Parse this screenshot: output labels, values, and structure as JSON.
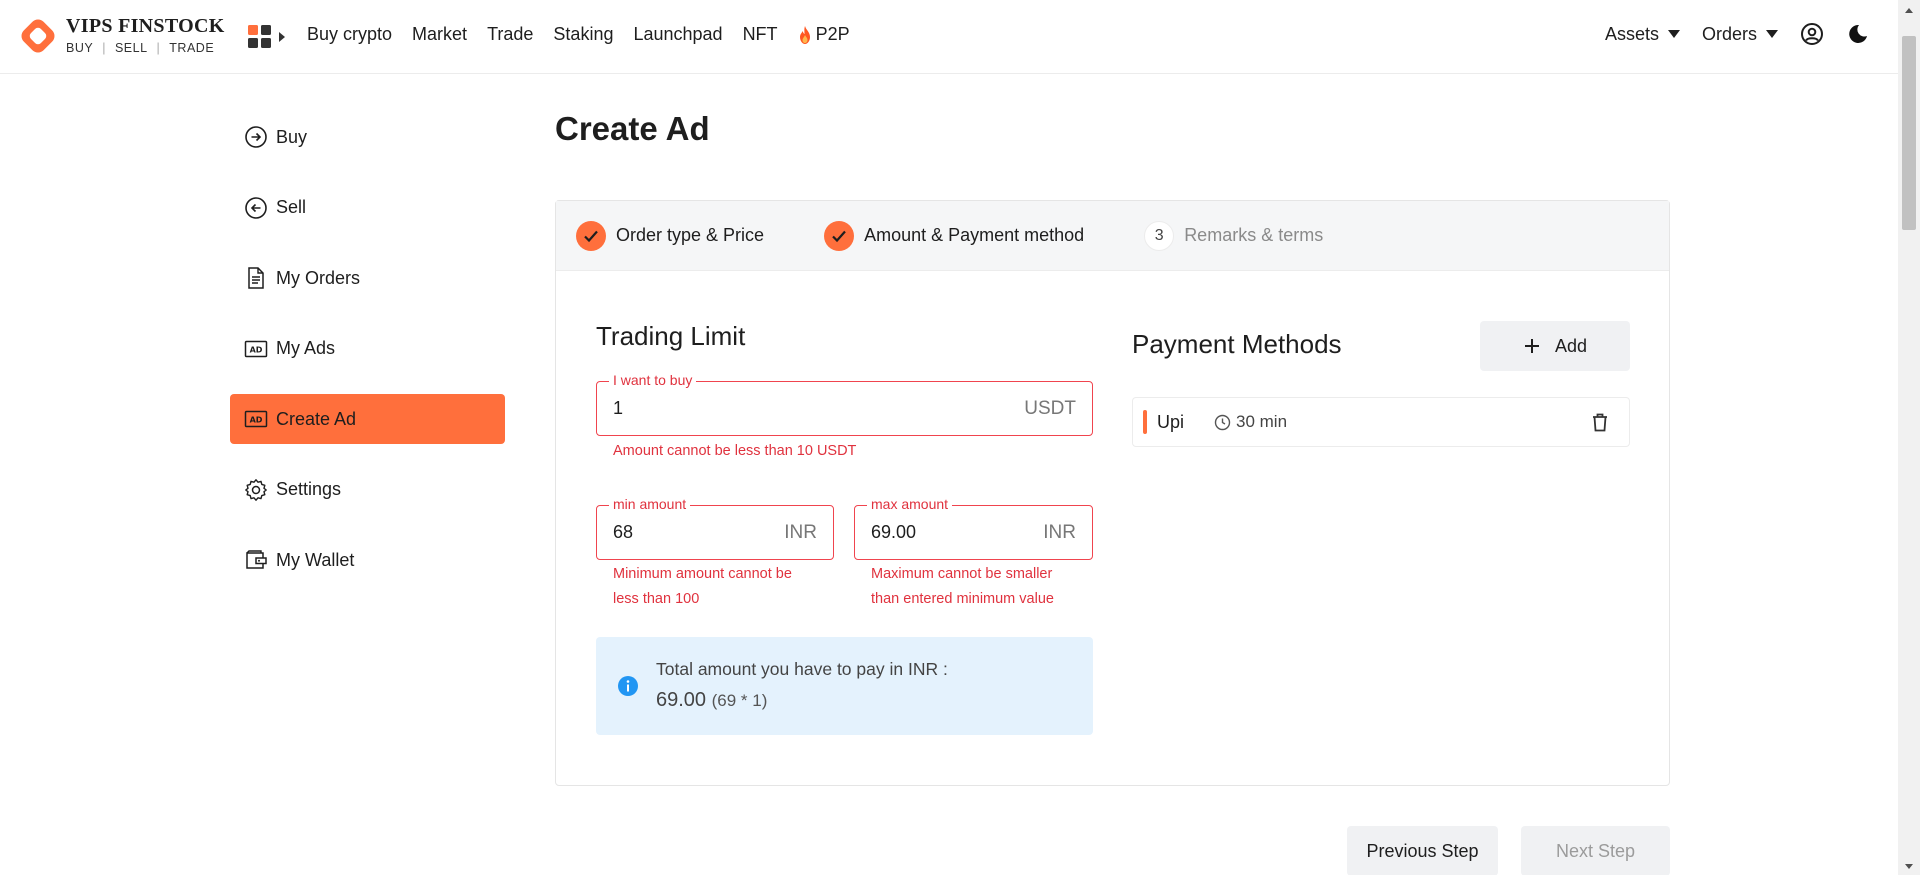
{
  "brand": {
    "name": "VIPS FINSTOCK",
    "tag_buy": "BUY",
    "tag_sell": "SELL",
    "tag_trade": "TRADE",
    "accent": "#ff6f3c"
  },
  "nav": {
    "links": [
      "Buy crypto",
      "Market",
      "Trade",
      "Staking",
      "Launchpad",
      "NFT",
      "P2P"
    ],
    "assets": "Assets",
    "orders": "Orders"
  },
  "sidebar": {
    "items": [
      {
        "label": "Buy",
        "icon": "arrow-right-circle-icon"
      },
      {
        "label": "Sell",
        "icon": "arrow-left-circle-icon"
      },
      {
        "label": "My Orders",
        "icon": "document-icon"
      },
      {
        "label": "My Ads",
        "icon": "ad-icon"
      },
      {
        "label": "Create Ad",
        "icon": "ad-icon",
        "active": true
      },
      {
        "label": "Settings",
        "icon": "gear-icon"
      },
      {
        "label": "My Wallet",
        "icon": "wallet-icon"
      }
    ]
  },
  "main": {
    "title": "Create Ad",
    "steps": [
      {
        "label": "Order type & Price",
        "state": "done"
      },
      {
        "label": "Amount & Payment method",
        "state": "done"
      },
      {
        "label": "Remarks & terms",
        "state": "pending",
        "number": "3"
      }
    ],
    "trading_limit": {
      "title": "Trading Limit",
      "buy_field": {
        "legend": "I want to buy",
        "value": "1",
        "unit": "USDT",
        "error": "Amount cannot be less than 10 USDT"
      },
      "min_field": {
        "legend": "min amount",
        "value": "68",
        "unit": "INR",
        "error_l1": "Minimum amount cannot be",
        "error_l2": "less than 100"
      },
      "max_field": {
        "legend": "max amount",
        "value": "69.00",
        "unit": "INR",
        "error_l1": "Maximum cannot be smaller",
        "error_l2": "than entered minimum value"
      }
    },
    "info": {
      "line1": "Total amount you have to pay in INR :",
      "total": "69.00",
      "calc": "(69 * 1)"
    },
    "payment": {
      "title": "Payment Methods",
      "add_label": "Add",
      "methods": [
        {
          "name": "Upi",
          "time": "30 min"
        }
      ]
    },
    "buttons": {
      "prev": "Previous Step",
      "next": "Next Step"
    }
  }
}
